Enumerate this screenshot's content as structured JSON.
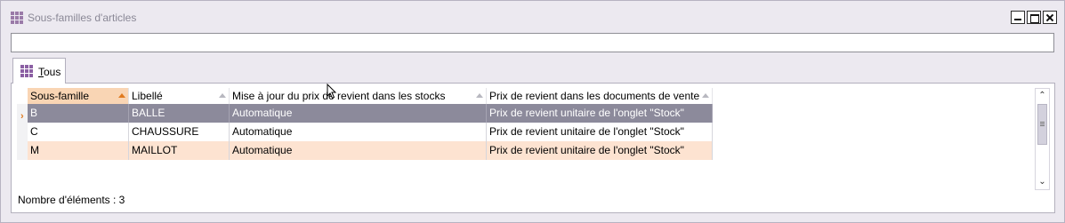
{
  "window": {
    "title": "Sous-familles d'articles",
    "controls": {
      "minimize": "minimize",
      "maximize": "maximize",
      "close": "close"
    }
  },
  "search": {
    "value": "",
    "placeholder": ""
  },
  "tabs": [
    {
      "prefix": "",
      "underlined": "T",
      "rest": "ous",
      "icon": "grid-icon"
    }
  ],
  "grid": {
    "columns": [
      {
        "label": "Sous-famille",
        "sorted": true
      },
      {
        "label": "Libellé",
        "sorted": false
      },
      {
        "label": "Mise à jour du prix de revient dans les stocks",
        "sorted": false
      },
      {
        "label": "Prix de revient dans les documents de vente",
        "sorted": false
      }
    ],
    "rows": [
      {
        "cells": [
          "B",
          "BALLE",
          "Automatique",
          "Prix de revient unitaire de l'onglet \"Stock\""
        ],
        "state": "selected"
      },
      {
        "cells": [
          "C",
          "CHAUSSURE",
          "Automatique",
          "Prix de revient unitaire de l'onglet \"Stock\""
        ],
        "state": "normal"
      },
      {
        "cells": [
          "M",
          "MAILLOT",
          "Automatique",
          "Prix de revient unitaire de l'onglet \"Stock\""
        ],
        "state": "alt"
      }
    ],
    "current_row_marker": "›"
  },
  "footer": {
    "count_label": "Nombre d'éléments : 3"
  },
  "colors": {
    "selected_row": "#8c8a9b",
    "alt_row": "#fde3d1",
    "sorted_header": "#f9d5b4",
    "accent": "#e07a1f",
    "icon": "#8b5fa3"
  }
}
